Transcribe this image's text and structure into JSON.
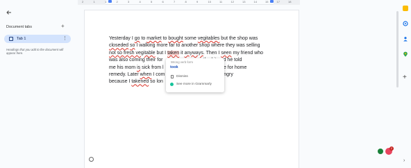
{
  "ruler": {
    "ticks": [
      "2",
      "1",
      "1",
      "2",
      "3",
      "4",
      "5",
      "6",
      "7",
      "8",
      "9",
      "10",
      "11",
      "12",
      "13",
      "14",
      "15",
      "17",
      "18"
    ]
  },
  "sidebar": {
    "back_icon": "arrow-back-icon",
    "title": "Document tabs",
    "add_symbol": "+",
    "tab": {
      "label": "Tab 1",
      "menu_symbol": "⋮"
    },
    "hint": "Headings that you add to the document will appear here."
  },
  "document": {
    "lines": [
      [
        "Yesterday I ",
        {
          "t": "go",
          "e": true
        },
        " to ",
        {
          "t": "market",
          "e": true
        },
        " to ",
        {
          "t": "bought",
          "e": true
        },
        " some ",
        {
          "t": "vegitables",
          "e": true
        },
        " but the shop was"
      ],
      [
        {
          "t": "closeded",
          "e": true
        },
        " ",
        {
          "t": "so",
          "e": true
        },
        " I walking more far to another shop where they was selling"
      ],
      [
        {
          "t": "not so fresh vegitable",
          "e": true
        },
        " but I ",
        {
          "t": "taken",
          "e": true,
          "h": true
        },
        " it ",
        {
          "t": "anyways",
          "e": true
        },
        ". Then I ",
        {
          "t": "seen",
          "e": true
        },
        " my friend who"
      ],
      [
        "was also coming their for",
        "                              ",
        {
          "t": "the",
          "e": true
        },
        " bit and he told"
      ],
      [
        "me his mom ",
        {
          "t": "is",
          "e": true
        },
        " sick from l",
        "                              ",
        "me advice for home"
      ],
      [
        "remedy. Later ",
        {
          "t": "when",
          "e": true
        },
        " I com",
        "                              ",
        "er was angry"
      ],
      [
        "because I ",
        {
          "t": "takened",
          "e": true
        },
        " so lon"
      ]
    ]
  },
  "popup": {
    "header": "Wrong verb form",
    "suggestion": "took",
    "dismiss_label": "Dismiss",
    "see_more_label": "See more in Grammarly",
    "accent": "#1a4fbb"
  },
  "rail": {
    "icons": [
      "calendar-icon",
      "keep-icon",
      "contacts-icon",
      "maps-icon"
    ],
    "add_symbol": "+",
    "collapse_symbol": "›"
  },
  "grammarly": {
    "count": "2"
  },
  "colors": {
    "error_underline": "#d93025",
    "selected_tab": "#d3e3fd",
    "grammarly_green": "#15c39a"
  }
}
